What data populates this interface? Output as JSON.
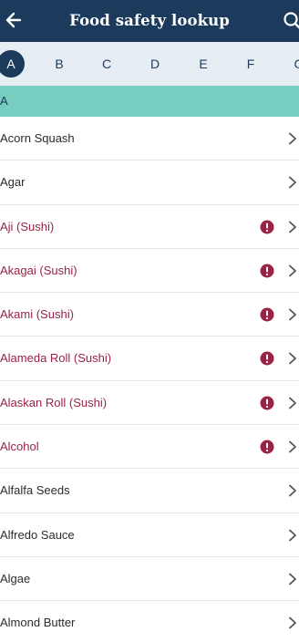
{
  "header": {
    "title": "Food safety lookup",
    "back_icon": "arrow-left-icon",
    "search_icon": "search-icon"
  },
  "alphabet": {
    "letters": [
      "A",
      "B",
      "C",
      "D",
      "E",
      "F",
      "G"
    ],
    "selected": "A"
  },
  "section": {
    "label": "A"
  },
  "items": [
    {
      "label": "Acorn Squash",
      "warning": false
    },
    {
      "label": "Agar",
      "warning": false
    },
    {
      "label": "Aji (Sushi)",
      "warning": true
    },
    {
      "label": "Akagai (Sushi)",
      "warning": true
    },
    {
      "label": "Akami (Sushi)",
      "warning": true
    },
    {
      "label": "Alameda Roll (Sushi)",
      "warning": true
    },
    {
      "label": "Alaskan Roll (Sushi)",
      "warning": true
    },
    {
      "label": "Alcohol",
      "warning": true
    },
    {
      "label": "Alfalfa Seeds",
      "warning": false
    },
    {
      "label": "Alfredo Sauce",
      "warning": false
    },
    {
      "label": "Algae",
      "warning": false
    },
    {
      "label": "Almond Butter",
      "warning": false
    }
  ],
  "colors": {
    "header_bg": "#1b3a5c",
    "alpha_bg": "#e6eef4",
    "section_bg": "#78cdc1",
    "warning": "#9b2344"
  }
}
